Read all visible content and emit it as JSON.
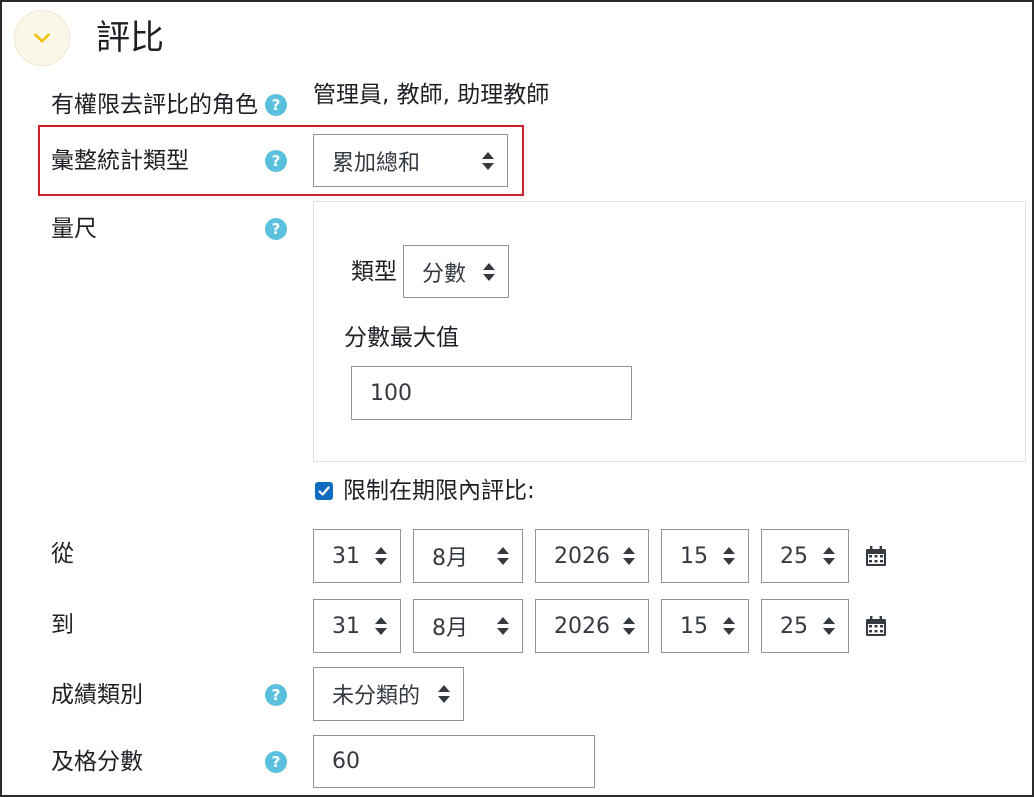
{
  "section": {
    "title": "評比",
    "collapse_icon": "chevron-down-icon"
  },
  "fields": {
    "roles": {
      "label": "有權限去評比的角色",
      "value": "管理員, 教師, 助理教師"
    },
    "aggregate": {
      "label": "彙整統計類型",
      "selected": "累加總和"
    },
    "scale": {
      "label": "量尺",
      "type_label": "類型",
      "type_selected": "分數",
      "max_label": "分數最大值",
      "max_value": "100"
    },
    "restrict": {
      "label": "限制在期限內評比:",
      "checked": true
    },
    "from": {
      "label": "從",
      "day": "31",
      "month": "8月",
      "year": "2026",
      "hour": "15",
      "minute": "25"
    },
    "to": {
      "label": "到",
      "day": "31",
      "month": "8月",
      "year": "2026",
      "hour": "15",
      "minute": "25"
    },
    "grade_category": {
      "label": "成績類別",
      "selected": "未分類的"
    },
    "pass_grade": {
      "label": "及格分數",
      "value": "60"
    }
  },
  "help_icon_text": "?",
  "colors": {
    "accent": "#0f6cbf",
    "help": "#5bc0de",
    "highlight": "#d0212b",
    "collapse_bg": "#fbf7e8"
  }
}
